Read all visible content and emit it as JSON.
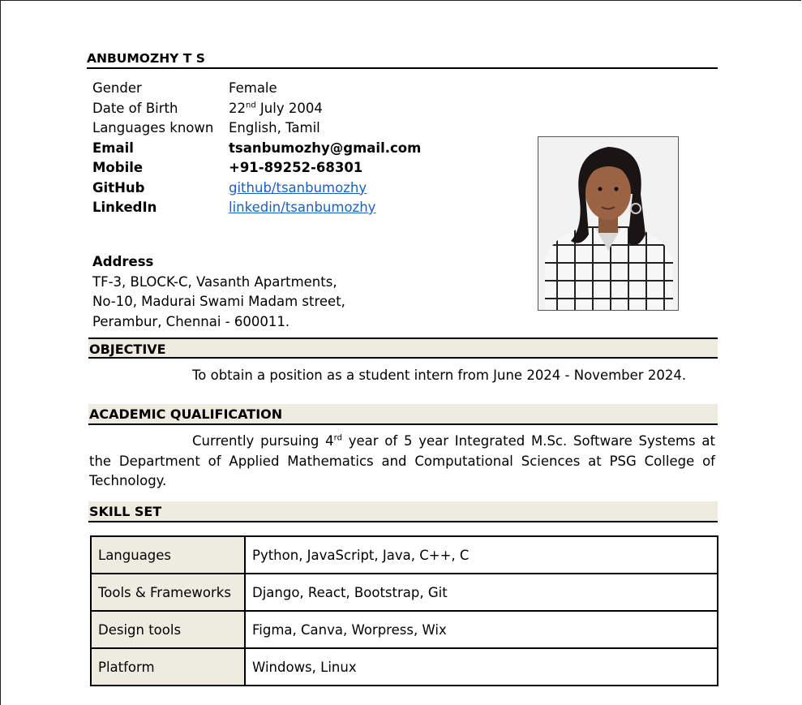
{
  "name": "ANBUMOZHY T S",
  "personal": {
    "gender": {
      "label": "Gender",
      "value": "Female"
    },
    "dob": {
      "label": "Date of Birth",
      "day": "22",
      "suffix": "nd",
      "rest": " July 2004"
    },
    "languages": {
      "label": "Languages known",
      "value": "English, Tamil"
    },
    "email": {
      "label": "Email",
      "value": "tsanbumozhy@gmail.com"
    },
    "mobile": {
      "label": "Mobile",
      "value": "+91-89252-68301"
    },
    "github": {
      "label": "GitHub",
      "value": "github/tsanbumozhy"
    },
    "linkedin": {
      "label": "LinkedIn",
      "value": "linkedin/tsanbumozhy"
    }
  },
  "address": {
    "heading": "Address",
    "lines": [
      "TF-3, BLOCK-C, Vasanth Apartments,",
      "No-10, Madurai Swami Madam street,",
      "Perambur, Chennai - 600011."
    ]
  },
  "objective": {
    "heading": "OBJECTIVE",
    "text": "To obtain a position as a student intern from June 2024 - November 2024."
  },
  "academic": {
    "heading": "ACADEMIC QUALIFICATION",
    "pre": "Currently pursuing 4",
    "sup": "rd",
    "post": " year of 5 year Integrated M.Sc. Software Systems at the Department of Applied Mathematics and Computational Sciences at PSG College of Technology."
  },
  "skills": {
    "heading": "SKILL SET",
    "rows": [
      {
        "key": "Languages",
        "value": "Python, JavaScript, Java, C++, C"
      },
      {
        "key": "Tools & Frameworks",
        "value": "Django, React, Bootstrap, Git"
      },
      {
        "key": "Design tools",
        "value": "Figma, Canva, Worpress, Wix"
      },
      {
        "key": "Platform",
        "value": "Windows, Linux"
      }
    ]
  }
}
